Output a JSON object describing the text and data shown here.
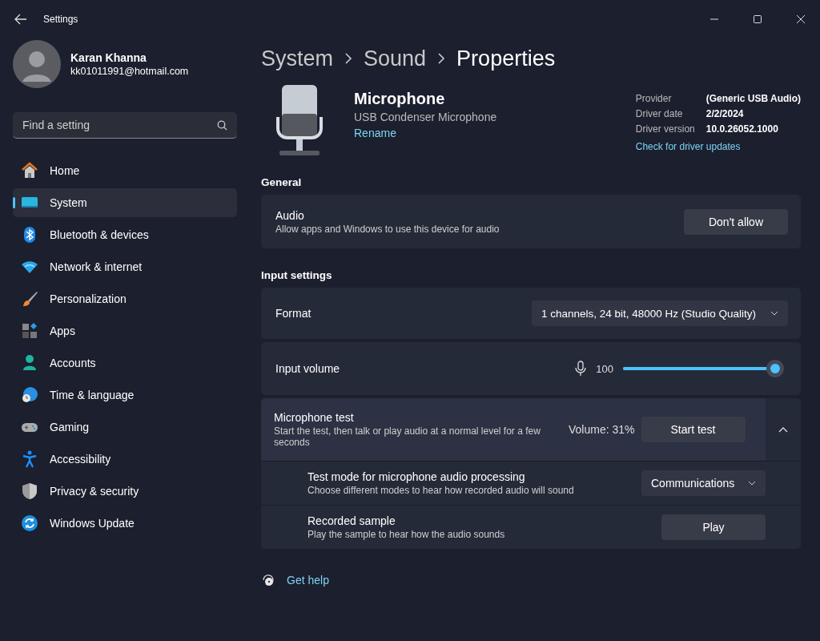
{
  "window": {
    "title": "Settings"
  },
  "account": {
    "name": "Karan Khanna",
    "email": "kk01011991@hotmail.com"
  },
  "search": {
    "placeholder": "Find a setting"
  },
  "sidebar": {
    "items": [
      {
        "label": "Home",
        "selected": false
      },
      {
        "label": "System",
        "selected": true
      },
      {
        "label": "Bluetooth & devices",
        "selected": false
      },
      {
        "label": "Network & internet",
        "selected": false
      },
      {
        "label": "Personalization",
        "selected": false
      },
      {
        "label": "Apps",
        "selected": false
      },
      {
        "label": "Accounts",
        "selected": false
      },
      {
        "label": "Time & language",
        "selected": false
      },
      {
        "label": "Gaming",
        "selected": false
      },
      {
        "label": "Accessibility",
        "selected": false
      },
      {
        "label": "Privacy & security",
        "selected": false
      },
      {
        "label": "Windows Update",
        "selected": false
      }
    ]
  },
  "breadcrumb": [
    "System",
    "Sound",
    "Properties"
  ],
  "device": {
    "name": "Microphone",
    "description": "USB Condenser Microphone",
    "rename_link": "Rename",
    "details": [
      {
        "label": "Provider",
        "value": "(Generic USB Audio)"
      },
      {
        "label": "Driver date",
        "value": "2/2/2024"
      },
      {
        "label": "Driver version",
        "value": "10.0.26052.1000"
      }
    ],
    "update_link": "Check for driver updates"
  },
  "general": {
    "heading": "General",
    "audio": {
      "title": "Audio",
      "description": "Allow apps and Windows to use this device for audio",
      "button": "Don't allow"
    }
  },
  "input_settings": {
    "heading": "Input settings",
    "format": {
      "label": "Format",
      "value": "1 channels, 24 bit, 48000 Hz (Studio Quality)"
    },
    "input_volume": {
      "label": "Input volume",
      "reading": "100",
      "level": 1.0
    },
    "mic_test": {
      "title": "Microphone test",
      "description": "Start the test, then talk or play audio at a normal level for a few seconds",
      "volume": "Volume: 31%",
      "button": "Start test",
      "expanded": true,
      "children": [
        {
          "kind": "dropdown",
          "title": "Test mode for microphone audio processing",
          "description": "Choose different modes to hear how recorded audio will sound",
          "control": "Communications"
        },
        {
          "kind": "button",
          "title": "Recorded sample",
          "description": "Play the sample to hear how the audio sounds",
          "control": "Play"
        }
      ]
    }
  },
  "help_link": "Get help"
}
